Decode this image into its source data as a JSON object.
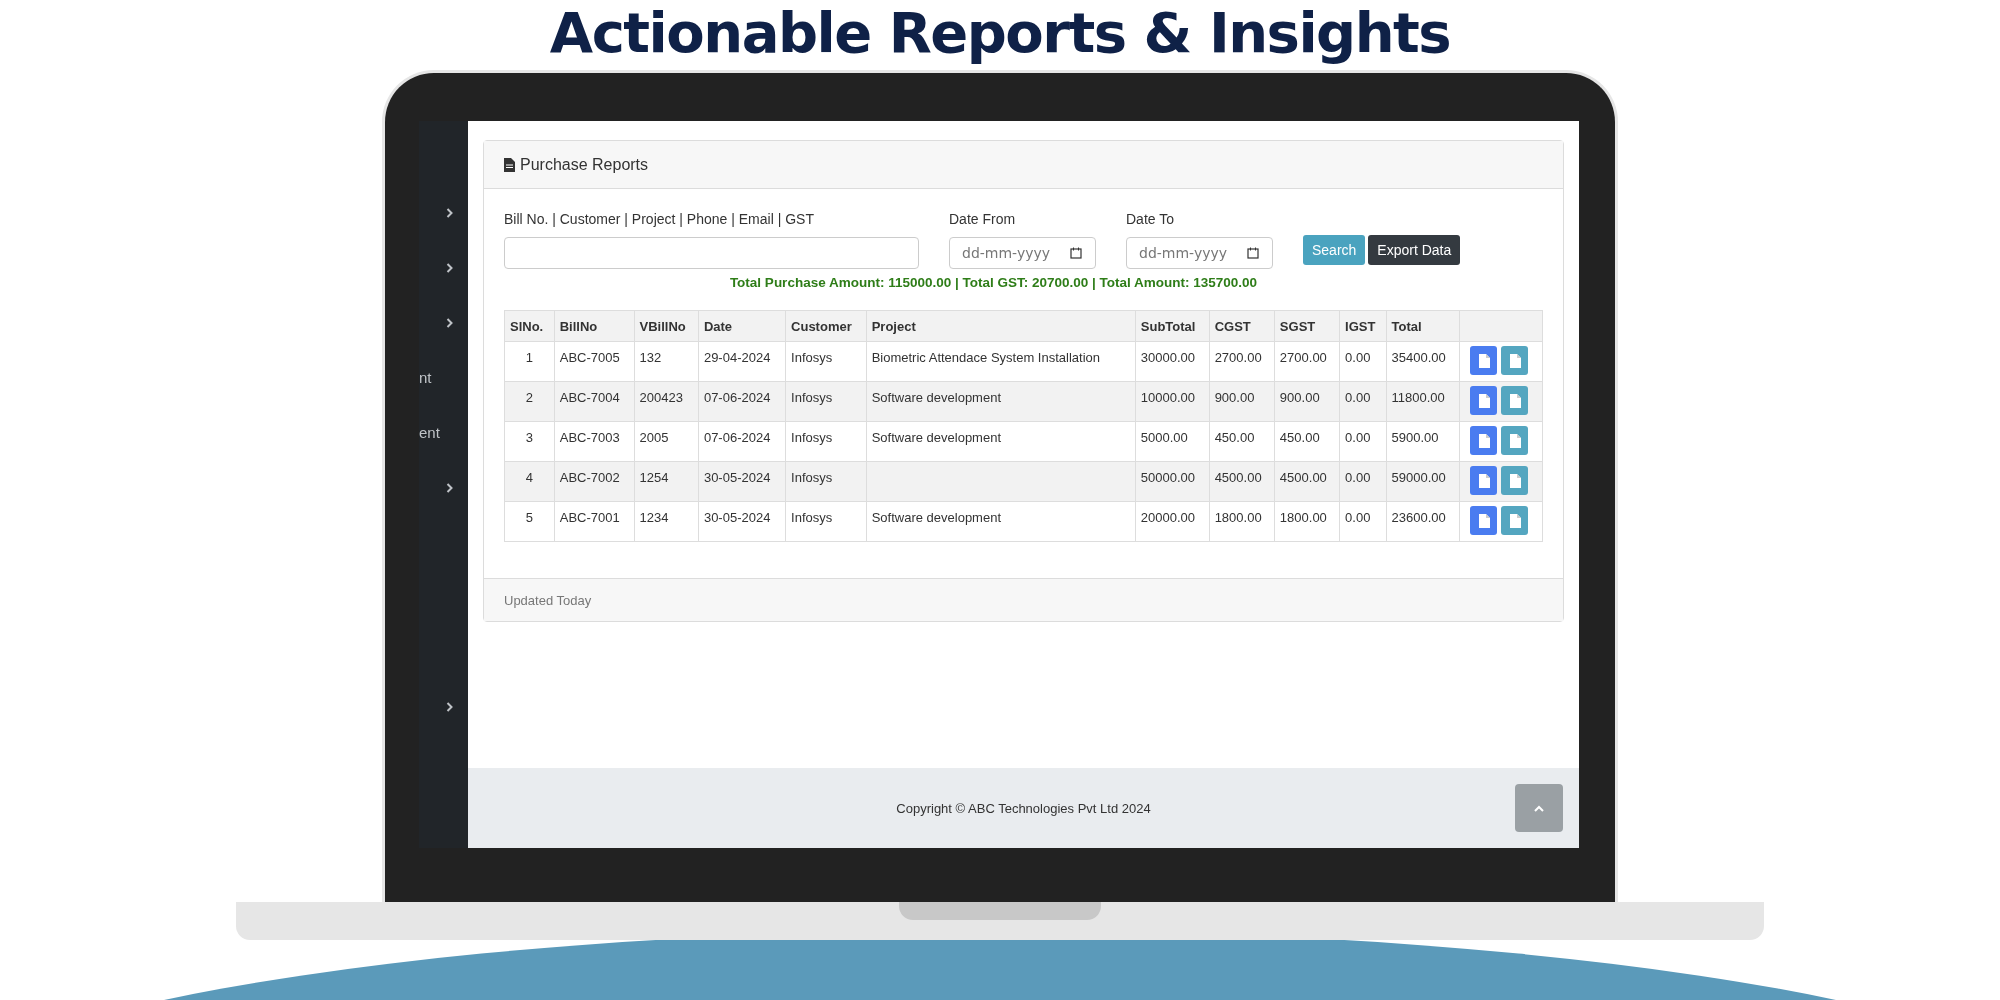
{
  "headline": "Actionable Reports & Insights",
  "sidebar": {
    "items": [
      {
        "kind": "chevron"
      },
      {
        "kind": "chevron"
      },
      {
        "kind": "chevron"
      },
      {
        "kind": "text",
        "label": "nt"
      },
      {
        "kind": "text",
        "label": "ent"
      },
      {
        "kind": "chevron"
      },
      {
        "kind": "spacer"
      },
      {
        "kind": "chevron"
      }
    ]
  },
  "card": {
    "title": "Purchase Reports",
    "filters": [
      {
        "label": "Bill No. | Customer | Project | Phone | Email | GST",
        "kind": "text"
      },
      {
        "label": "Date From",
        "kind": "date",
        "placeholder": "dd-mm-yyyy"
      },
      {
        "label": "Date To",
        "kind": "date",
        "placeholder": "dd-mm-yyyy"
      }
    ],
    "buttons": [
      {
        "label": "Search",
        "kind": "primary"
      },
      {
        "label": "Export Data",
        "kind": "dark"
      }
    ],
    "totals": "Total Purchase Amount: 115000.00 | Total GST: 20700.00 | Total Amount: 135700.00",
    "table": {
      "columns": [
        "SlNo.",
        "BillNo",
        "VBillNo",
        "Date",
        "Customer",
        "Project",
        "SubTotal",
        "CGST",
        "SGST",
        "IGST",
        "Total"
      ],
      "rows": [
        [
          "1",
          "ABC-7005",
          "132",
          "29-04-2024",
          "Infosys",
          "Biometric Attendace System Installation",
          "30000.00",
          "2700.00",
          "2700.00",
          "0.00",
          "35400.00"
        ],
        [
          "2",
          "ABC-7004",
          "200423",
          "07-06-2024",
          "Infosys",
          "Software development",
          "10000.00",
          "900.00",
          "900.00",
          "0.00",
          "11800.00"
        ],
        [
          "3",
          "ABC-7003",
          "2005",
          "07-06-2024",
          "Infosys",
          "Software development",
          "5000.00",
          "450.00",
          "450.00",
          "0.00",
          "5900.00"
        ],
        [
          "4",
          "ABC-7002",
          "1254",
          "30-05-2024",
          "Infosys",
          "",
          "50000.00",
          "4500.00",
          "4500.00",
          "0.00",
          "59000.00"
        ],
        [
          "5",
          "ABC-7001",
          "1234",
          "30-05-2024",
          "Infosys",
          "Software development",
          "20000.00",
          "1800.00",
          "1800.00",
          "0.00",
          "23600.00"
        ]
      ]
    },
    "footer": "Updated Today"
  },
  "page_footer": {
    "copyright": "Copyright © ABC Technologies Pvt Ltd 2024"
  }
}
